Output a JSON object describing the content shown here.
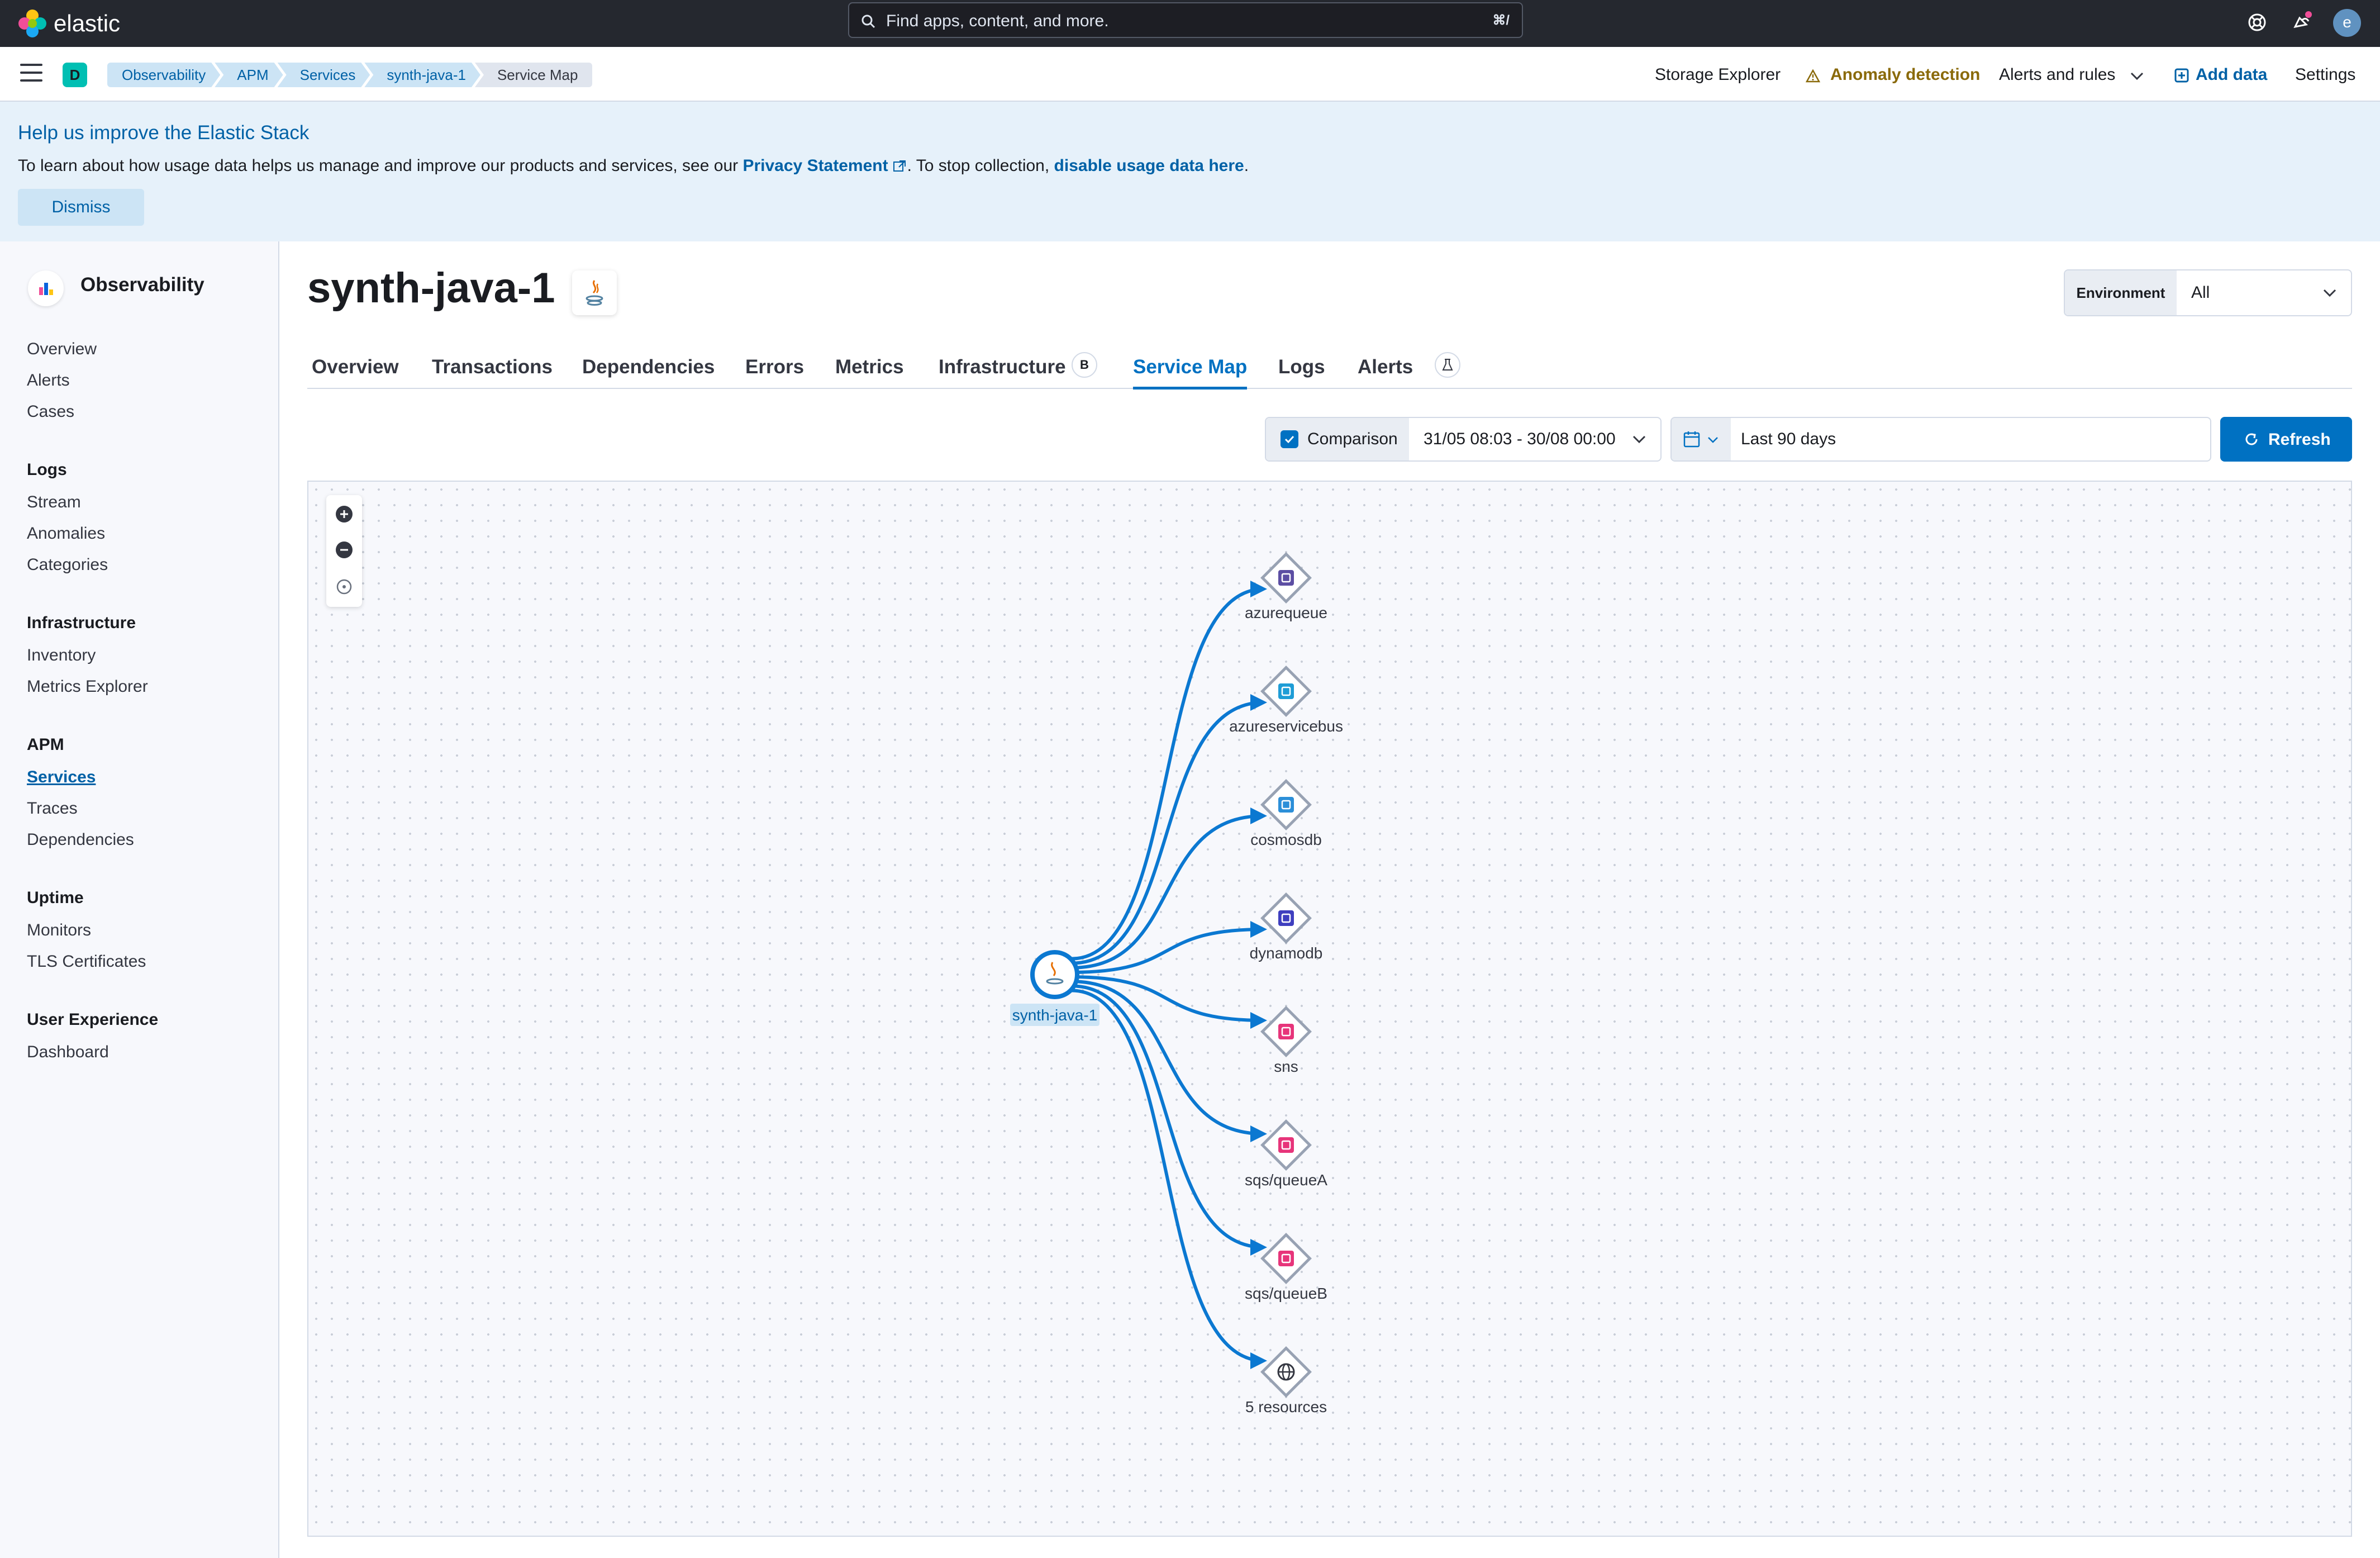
{
  "header": {
    "brand": "elastic",
    "search_placeholder": "Find apps, content, and more.",
    "search_shortcut": "⌘/",
    "avatar_initial": "e"
  },
  "subnav": {
    "space_initial": "D",
    "breadcrumbs": [
      "Observability",
      "APM",
      "Services",
      "synth-java-1",
      "Service Map"
    ],
    "links": {
      "storage_explorer": "Storage Explorer",
      "anomaly_detection": "Anomaly detection",
      "alerts_and_rules": "Alerts and rules",
      "add_data": "Add data",
      "settings": "Settings"
    }
  },
  "banner": {
    "title": "Help us improve the Elastic Stack",
    "text_prefix": "To learn about how usage data helps us manage and improve our products and services, see our ",
    "privacy_link": "Privacy Statement",
    "text_mid": ". To stop collection, ",
    "disable_link": "disable usage data here",
    "text_suffix": ".",
    "dismiss": "Dismiss"
  },
  "sidebar": {
    "title": "Observability",
    "top_items": [
      "Overview",
      "Alerts",
      "Cases"
    ],
    "groups": [
      {
        "title": "Logs",
        "items": [
          "Stream",
          "Anomalies",
          "Categories"
        ]
      },
      {
        "title": "Infrastructure",
        "items": [
          "Inventory",
          "Metrics Explorer"
        ]
      },
      {
        "title": "APM",
        "items": [
          "Services",
          "Traces",
          "Dependencies"
        ]
      },
      {
        "title": "Uptime",
        "items": [
          "Monitors",
          "TLS Certificates"
        ]
      },
      {
        "title": "User Experience",
        "items": [
          "Dashboard"
        ]
      }
    ],
    "active_item": "Services"
  },
  "main": {
    "title": "synth-java-1",
    "environment_label": "Environment",
    "environment_value": "All",
    "tabs": [
      "Overview",
      "Transactions",
      "Dependencies",
      "Errors",
      "Metrics",
      "Infrastructure",
      "Service Map",
      "Logs",
      "Alerts"
    ],
    "active_tab": "Service Map",
    "infrastructure_badge": "B",
    "comparison_label": "Comparison",
    "comparison_checked": true,
    "comparison_range": "31/05 08:03 - 30/08 00:00",
    "date_range": "Last 90 days",
    "refresh": "Refresh"
  },
  "service_map": {
    "center_node": "synth-java-1",
    "dependencies": [
      {
        "name": "azurequeue",
        "icon": "azure-queue-icon",
        "color": "#5c4ea3"
      },
      {
        "name": "azureservicebus",
        "icon": "azure-service-bus-icon",
        "color": "#1f9dd6"
      },
      {
        "name": "cosmosdb",
        "icon": "cosmosdb-icon",
        "color": "#2c8fd8"
      },
      {
        "name": "dynamodb",
        "icon": "dynamodb-icon",
        "color": "#3f3fbf"
      },
      {
        "name": "sns",
        "icon": "sns-icon",
        "color": "#e7357a"
      },
      {
        "name": "sqs/queueA",
        "icon": "sqs-icon",
        "color": "#e7357a"
      },
      {
        "name": "sqs/queueB",
        "icon": "sqs-icon",
        "color": "#e7357a"
      },
      {
        "name": "5 resources",
        "icon": "globe-icon",
        "color": "#343741"
      }
    ],
    "edge_color": "#0b78d1"
  }
}
